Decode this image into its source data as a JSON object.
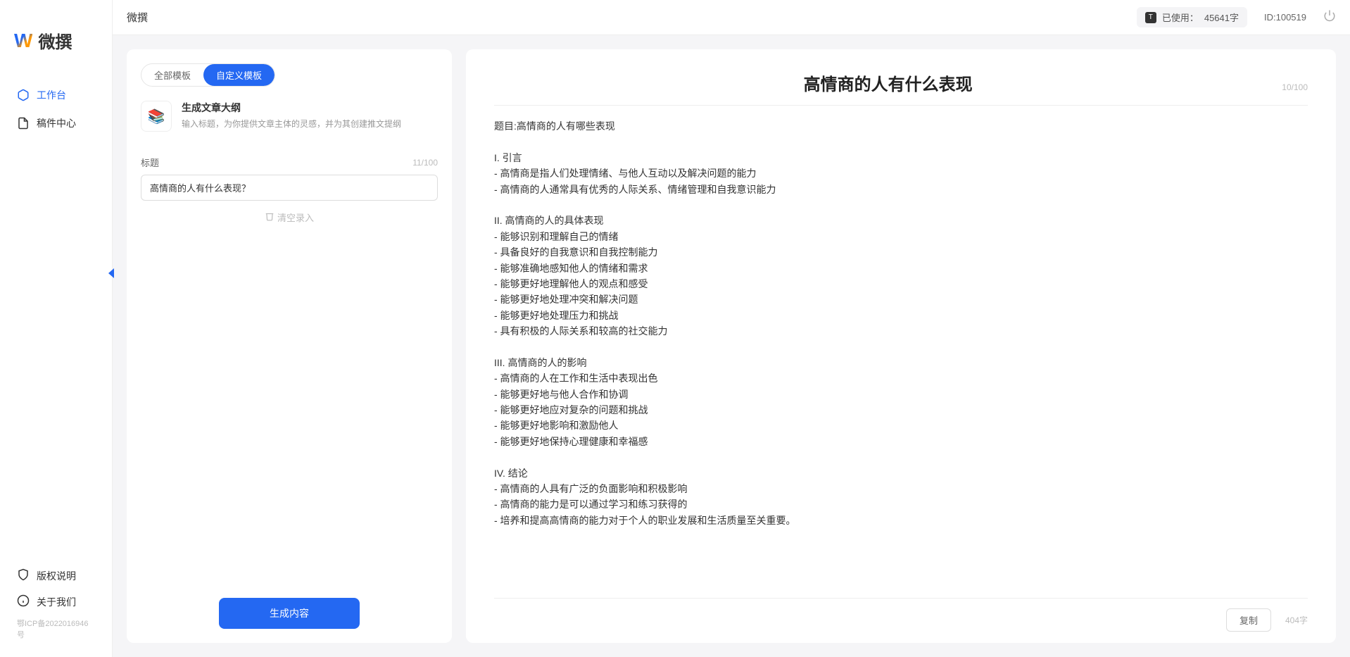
{
  "app": {
    "name": "微撰",
    "logo_text": "微撰"
  },
  "sidebar": {
    "nav": [
      {
        "label": "工作台",
        "icon": "cube-icon",
        "active": true
      },
      {
        "label": "稿件中心",
        "icon": "document-icon",
        "active": false
      }
    ],
    "bottom": [
      {
        "label": "版权说明",
        "icon": "shield-icon"
      },
      {
        "label": "关于我们",
        "icon": "info-icon"
      }
    ],
    "icp": "鄂ICP备2022016946号"
  },
  "topbar": {
    "title": "微撰",
    "usage_prefix": "已使用：",
    "usage_value": "45641字",
    "user_id": "ID:100519"
  },
  "left_panel": {
    "tabs": {
      "all": "全部模板",
      "custom": "自定义模板"
    },
    "template": {
      "title": "生成文章大纲",
      "desc": "输入标题，为你提供文章主体的灵感，并为其创建推文提纲"
    },
    "field": {
      "label": "标题",
      "count": "11/100",
      "value": "高情商的人有什么表现？"
    },
    "clear": "清空录入",
    "generate": "生成内容"
  },
  "right_panel": {
    "title": "高情商的人有什么表现",
    "title_count": "10/100",
    "body": "题目:高情商的人有哪些表现\n\nI. 引言\n- 高情商是指人们处理情绪、与他人互动以及解决问题的能力\n- 高情商的人通常具有优秀的人际关系、情绪管理和自我意识能力\n\nII. 高情商的人的具体表现\n- 能够识别和理解自己的情绪\n- 具备良好的自我意识和自我控制能力\n- 能够准确地感知他人的情绪和需求\n- 能够更好地理解他人的观点和感受\n- 能够更好地处理冲突和解决问题\n- 能够更好地处理压力和挑战\n- 具有积极的人际关系和较高的社交能力\n\nIII. 高情商的人的影响\n- 高情商的人在工作和生活中表现出色\n- 能够更好地与他人合作和协调\n- 能够更好地应对复杂的问题和挑战\n- 能够更好地影响和激励他人\n- 能够更好地保持心理健康和幸福感\n\nIV. 结论\n- 高情商的人具有广泛的负面影响和积极影响\n- 高情商的能力是可以通过学习和练习获得的\n- 培养和提高高情商的能力对于个人的职业发展和生活质量至关重要。",
    "copy": "复制",
    "word_count": "404字"
  }
}
